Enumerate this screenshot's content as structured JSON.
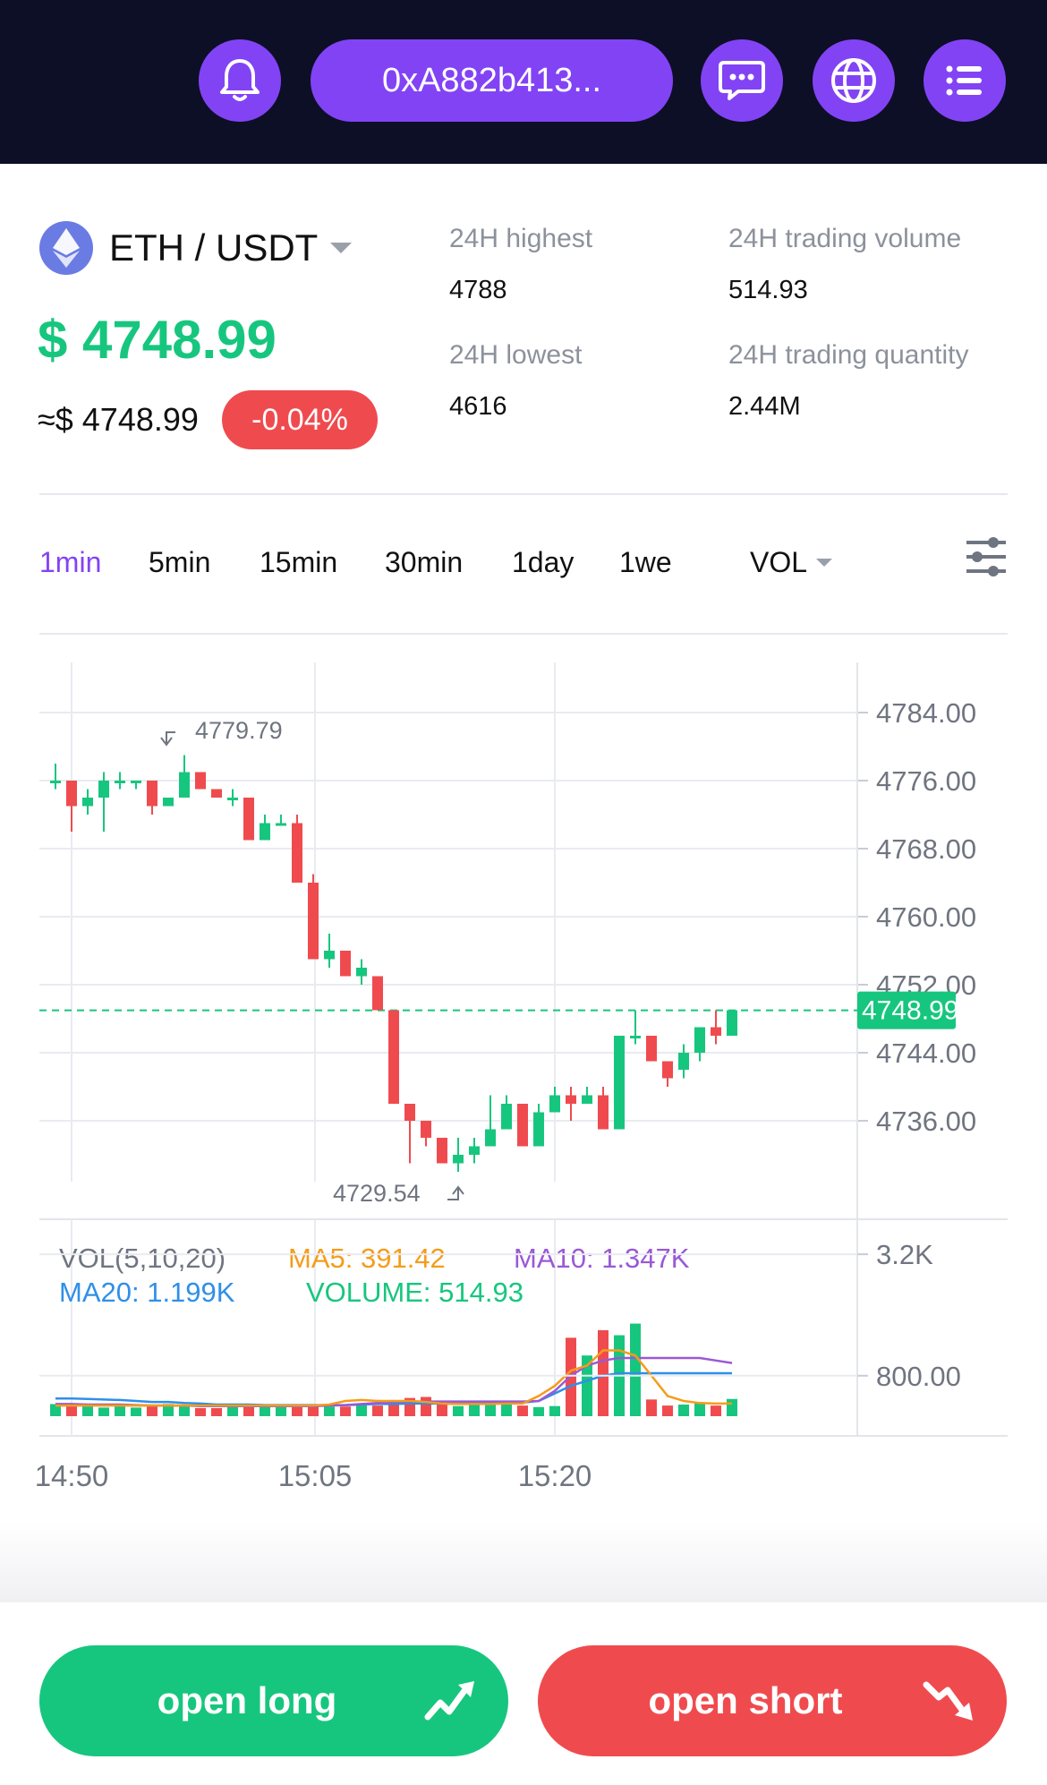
{
  "header": {
    "wallet_address": "0xA882b413...",
    "icons": [
      "bell-icon",
      "chat-icon",
      "globe-icon",
      "menu-icon"
    ]
  },
  "market": {
    "pair": "ETH / USDT",
    "price": "$ 4748.99",
    "approx_price": "≈$ 4748.99",
    "change": "-0.04%",
    "stats": {
      "high_label": "24H highest",
      "high_value": "4788",
      "low_label": "24H lowest",
      "low_value": "4616",
      "volume_label": "24H trading volume",
      "volume_value": "514.93",
      "quantity_label": "24H trading quantity",
      "quantity_value": "2.44M"
    }
  },
  "timeframes": {
    "tab_1min": "1min",
    "tab_5min": "5min",
    "tab_15min": "15min",
    "tab_30min": "30min",
    "tab_1day": "1day",
    "tab_1week": "1we",
    "indicator": "VOL",
    "active": "1min"
  },
  "chart_data": {
    "type": "candlestick",
    "price_axis_labels": [
      "4784.00",
      "4776.00",
      "4768.00",
      "4760.00",
      "4752.00",
      "4744.00",
      "4736.00"
    ],
    "volume_axis_labels": [
      "3.2K",
      "800.00"
    ],
    "time_labels": [
      "14:50",
      "15:05",
      "15:20"
    ],
    "current_price_label": "4748.99",
    "high_marker": "4779.79",
    "low_marker": "4729.54",
    "volume_legend": {
      "title": "VOL(5,10,20)",
      "ma5": "MA5: 391.42",
      "ma10": "MA10: 1.347K",
      "ma20": "MA20: 1.199K",
      "volume": "VOLUME: 514.93"
    },
    "candles": [
      {
        "o": 4776,
        "c": 4776,
        "h": 4778,
        "l": 4775
      },
      {
        "o": 4776,
        "c": 4773,
        "h": 4776,
        "l": 4770
      },
      {
        "o": 4773,
        "c": 4774,
        "h": 4775,
        "l": 4772
      },
      {
        "o": 4774,
        "c": 4776,
        "h": 4777,
        "l": 4770
      },
      {
        "o": 4776,
        "c": 4776,
        "h": 4777,
        "l": 4775
      },
      {
        "o": 4776,
        "c": 4776,
        "h": 4776,
        "l": 4775
      },
      {
        "o": 4776,
        "c": 4773,
        "h": 4776,
        "l": 4772
      },
      {
        "o": 4773,
        "c": 4774,
        "h": 4774,
        "l": 4773
      },
      {
        "o": 4774,
        "c": 4777,
        "h": 4779,
        "l": 4774
      },
      {
        "o": 4777,
        "c": 4775,
        "h": 4777,
        "l": 4775
      },
      {
        "o": 4775,
        "c": 4774,
        "h": 4775,
        "l": 4774
      },
      {
        "o": 4774,
        "c": 4774,
        "h": 4775,
        "l": 4773
      },
      {
        "o": 4774,
        "c": 4769,
        "h": 4774,
        "l": 4769
      },
      {
        "o": 4769,
        "c": 4771,
        "h": 4772,
        "l": 4769
      },
      {
        "o": 4771,
        "c": 4771,
        "h": 4772,
        "l": 4771
      },
      {
        "o": 4771,
        "c": 4764,
        "h": 4772,
        "l": 4764
      },
      {
        "o": 4764,
        "c": 4755,
        "h": 4765,
        "l": 4755
      },
      {
        "o": 4755,
        "c": 4756,
        "h": 4758,
        "l": 4754
      },
      {
        "o": 4756,
        "c": 4753,
        "h": 4756,
        "l": 4753
      },
      {
        "o": 4753,
        "c": 4754,
        "h": 4755,
        "l": 4752
      },
      {
        "o": 4753,
        "c": 4749,
        "h": 4753,
        "l": 4749
      },
      {
        "o": 4749,
        "c": 4738,
        "h": 4749,
        "l": 4738
      },
      {
        "o": 4738,
        "c": 4736,
        "h": 4738,
        "l": 4731
      },
      {
        "o": 4736,
        "c": 4734,
        "h": 4736,
        "l": 4733
      },
      {
        "o": 4734,
        "c": 4731,
        "h": 4734,
        "l": 4731
      },
      {
        "o": 4731,
        "c": 4732,
        "h": 4734,
        "l": 4730
      },
      {
        "o": 4732,
        "c": 4733,
        "h": 4734,
        "l": 4731
      },
      {
        "o": 4733,
        "c": 4735,
        "h": 4739,
        "l": 4733
      },
      {
        "o": 4735,
        "c": 4738,
        "h": 4739,
        "l": 4735
      },
      {
        "o": 4738,
        "c": 4733,
        "h": 4738,
        "l": 4733
      },
      {
        "o": 4733,
        "c": 4737,
        "h": 4738,
        "l": 4733
      },
      {
        "o": 4737,
        "c": 4739,
        "h": 4740,
        "l": 4737
      },
      {
        "o": 4739,
        "c": 4738,
        "h": 4740,
        "l": 4736
      },
      {
        "o": 4738,
        "c": 4739,
        "h": 4740,
        "l": 4738
      },
      {
        "o": 4739,
        "c": 4735,
        "h": 4740,
        "l": 4735
      },
      {
        "o": 4735,
        "c": 4746,
        "h": 4746,
        "l": 4735
      },
      {
        "o": 4746,
        "c": 4746,
        "h": 4749,
        "l": 4745
      },
      {
        "o": 4746,
        "c": 4743,
        "h": 4746,
        "l": 4743
      },
      {
        "o": 4743,
        "c": 4741,
        "h": 4743,
        "l": 4740
      },
      {
        "o": 4742,
        "c": 4744,
        "h": 4745,
        "l": 4741
      },
      {
        "o": 4744,
        "c": 4747,
        "h": 4747,
        "l": 4743
      },
      {
        "o": 4747,
        "c": 4746,
        "h": 4749,
        "l": 4745
      },
      {
        "o": 4746,
        "c": 4749,
        "h": 4749,
        "l": 4746
      }
    ],
    "volumes": [
      240,
      230,
      240,
      170,
      210,
      170,
      210,
      240,
      200,
      160,
      160,
      240,
      200,
      200,
      180,
      190,
      190,
      190,
      190,
      240,
      210,
      300,
      360,
      380,
      230,
      200,
      240,
      300,
      280,
      210,
      180,
      200,
      1550,
      1200,
      1700,
      1600,
      1830,
      330,
      210,
      230,
      260,
      210,
      340
    ],
    "ma5": [
      210,
      210,
      210,
      210,
      210,
      210,
      210,
      210,
      210,
      210,
      210,
      210,
      210,
      210,
      210,
      210,
      210,
      230,
      300,
      320,
      300,
      300,
      300,
      280,
      250,
      240,
      240,
      240,
      250,
      250,
      400,
      600,
      900,
      1000,
      1300,
      1300,
      1200,
      800,
      400,
      300,
      260,
      250,
      250
    ],
    "ma10": [
      240,
      240,
      230,
      230,
      230,
      220,
      210,
      210,
      210,
      200,
      200,
      200,
      200,
      200,
      200,
      200,
      200,
      210,
      220,
      240,
      260,
      280,
      290,
      290,
      290,
      290,
      290,
      290,
      290,
      290,
      300,
      500,
      800,
      1000,
      1100,
      1150,
      1150,
      1150,
      1150,
      1150,
      1150,
      1100,
      1050
    ],
    "ma20": [
      350,
      350,
      340,
      330,
      320,
      300,
      280,
      280,
      260,
      250,
      230,
      230,
      230,
      220,
      220,
      220,
      220,
      220,
      220,
      230,
      240,
      240,
      250,
      250,
      250,
      250,
      260,
      260,
      270,
      270,
      300,
      450,
      600,
      700,
      800,
      850,
      850,
      850,
      850,
      850,
      850,
      850,
      850
    ],
    "colors": {
      "up": "#17c67e",
      "down": "#ef4b4f",
      "ma5": "#f59c1a",
      "ma10": "#9a58d6",
      "ma20": "#2f8fe8"
    }
  },
  "actions": {
    "open_long": "open long",
    "open_short": "open short"
  }
}
